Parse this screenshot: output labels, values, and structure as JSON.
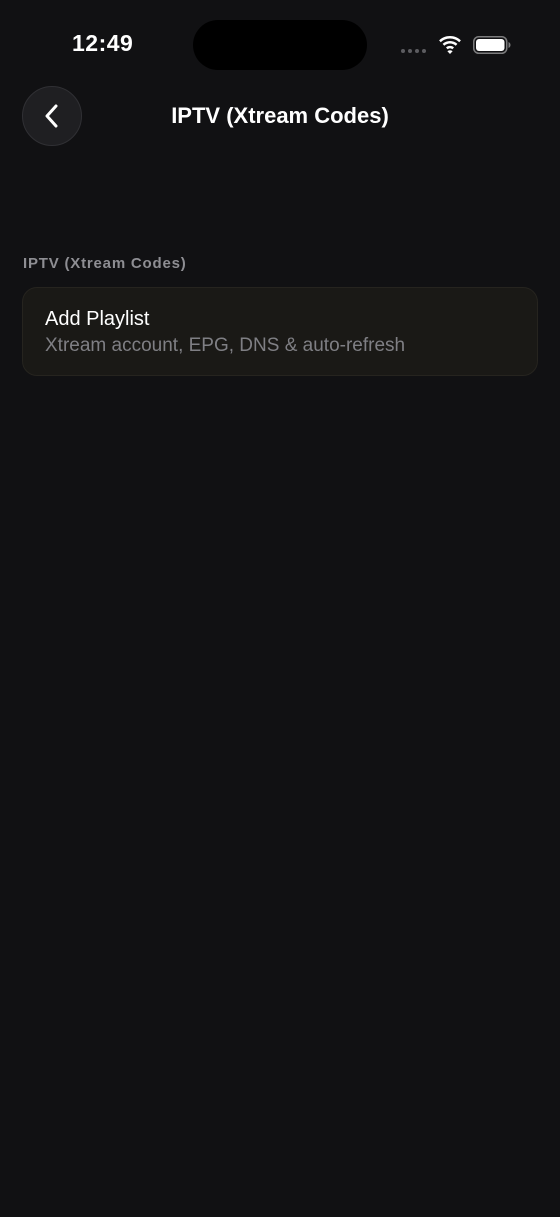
{
  "status_bar": {
    "time": "12:49",
    "icons": [
      "signal-dots-icon",
      "wifi-icon",
      "battery-icon"
    ]
  },
  "nav": {
    "back_icon": "chevron-left-icon",
    "title": "IPTV (Xtream Codes)"
  },
  "section": {
    "header": "IPTV (Xtream Codes)",
    "items": [
      {
        "title": "Add Playlist",
        "subtitle": "Xtream account, EPG, DNS & auto-refresh"
      }
    ]
  },
  "colors": {
    "background": "#111113",
    "card": "#1a1916",
    "secondary_text": "#7f7f84"
  }
}
